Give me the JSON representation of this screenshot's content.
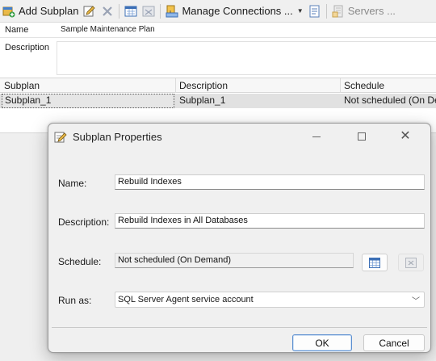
{
  "toolbar": {
    "add_subplan": "Add Subplan",
    "manage_connections": "Manage Connections ...",
    "servers": "Servers ..."
  },
  "properties": {
    "name_label": "Name",
    "name_value": "Sample Maintenance Plan",
    "description_label": "Description",
    "description_value": ""
  },
  "grid": {
    "columns": [
      "Subplan",
      "Description",
      "Schedule"
    ],
    "rows": [
      {
        "subplan": "Subplan_1",
        "description": "Subplan_1",
        "schedule": "Not scheduled (On Dem"
      }
    ]
  },
  "dialog": {
    "title": "Subplan Properties",
    "name_label": "Name:",
    "name_value": "Rebuild Indexes",
    "description_label": "Description:",
    "description_value": "Rebuild Indexes in All Databases",
    "schedule_label": "Schedule:",
    "schedule_value": "Not scheduled (On Demand)",
    "run_as_label": "Run as:",
    "run_as_value": "SQL Server Agent service account",
    "ok_label": "OK",
    "cancel_label": "Cancel"
  },
  "icons": {
    "add_subplan": "add-subplan-icon",
    "edit": "edit-icon",
    "delete": "delete-icon",
    "schedule": "calendar-icon",
    "schedule_remove": "remove-schedule-icon",
    "connections": "connections-icon",
    "reporting": "reporting-icon",
    "servers": "servers-icon",
    "dialog": "properties-icon"
  },
  "colors": {
    "toolbar_bg": "#f0f0f0",
    "dialog_bg": "#f0f0f0",
    "selected_row": "#e1e1e1",
    "ok_border": "#5b8fd0"
  }
}
